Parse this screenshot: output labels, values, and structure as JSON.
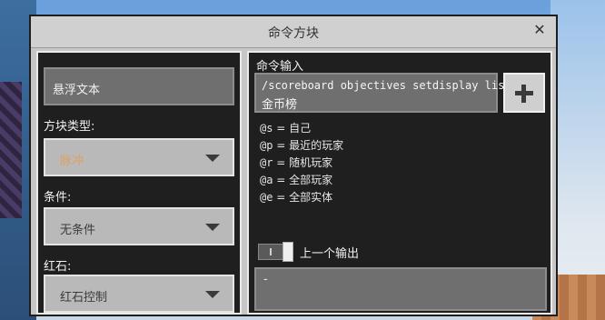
{
  "window": {
    "title": "命令方块"
  },
  "hover_text": {
    "placeholder": "悬浮文本"
  },
  "block_type": {
    "label": "方块类型:",
    "value": "脉冲",
    "value_color": "#e0a060"
  },
  "condition": {
    "label": "条件:",
    "value": "无条件"
  },
  "redstone": {
    "label": "红石:",
    "value": "红石控制"
  },
  "command": {
    "label": "命令输入",
    "line1": "/scoreboard objectives setdisplay list",
    "line2": "金币榜"
  },
  "selectors": [
    {
      "code": "@s",
      "desc": "= 自己"
    },
    {
      "code": "@p",
      "desc": "= 最近的玩家"
    },
    {
      "code": "@r",
      "desc": "= 随机玩家"
    },
    {
      "code": "@a",
      "desc": "= 全部玩家"
    },
    {
      "code": "@e",
      "desc": "= 全部实体"
    }
  ],
  "previous_output": {
    "label": "上一个输出",
    "value": "-"
  },
  "icons": {
    "close": "close-icon",
    "add": "plus-icon",
    "dropdown": "caret-down-icon"
  }
}
